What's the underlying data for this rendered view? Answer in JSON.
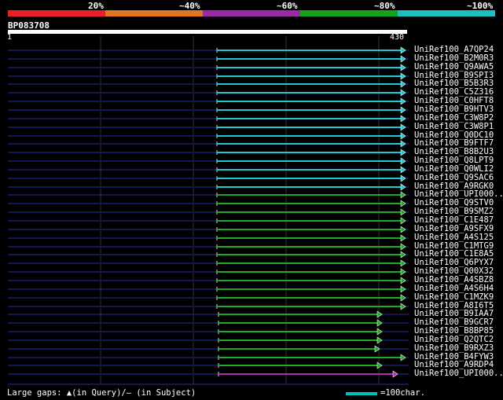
{
  "query": {
    "name": "BP083708",
    "start": "1",
    "end": "430"
  },
  "legend": {
    "labels": [
      "20%",
      "~40%",
      "~60%",
      "~80%",
      "~100%"
    ],
    "colors": [
      "#e8202a",
      "#e07820",
      "#9a2aa8",
      "#17a317",
      "#1fbfbf"
    ]
  },
  "footer": {
    "gaps_text": "Large gaps: ▲(in Query)/– (in Subject)",
    "scale_text": "=100char."
  },
  "hits": [
    {
      "label": "UniRef100_A7QP24",
      "color": "cyan",
      "kind": "long"
    },
    {
      "label": "UniRef100_B2M0R3",
      "color": "cyan",
      "kind": "long"
    },
    {
      "label": "UniRef100_Q9AWA5",
      "color": "cyan",
      "kind": "long"
    },
    {
      "label": "UniRef100_B9SPI3",
      "color": "cyan",
      "kind": "long"
    },
    {
      "label": "UniRef100_B5B3R3",
      "color": "cyan",
      "kind": "long"
    },
    {
      "label": "UniRef100_C5Z316",
      "color": "cyan",
      "kind": "long"
    },
    {
      "label": "UniRef100_C0HFT8",
      "color": "cyan",
      "kind": "long"
    },
    {
      "label": "UniRef100_B9HTV3",
      "color": "cyan",
      "kind": "long"
    },
    {
      "label": "UniRef100_C3W8P2",
      "color": "cyan",
      "kind": "long"
    },
    {
      "label": "UniRef100_C3W8P1",
      "color": "cyan",
      "kind": "long"
    },
    {
      "label": "UniRef100_Q0DC10",
      "color": "cyan",
      "kind": "long"
    },
    {
      "label": "UniRef100_B9FTF7",
      "color": "cyan",
      "kind": "long"
    },
    {
      "label": "UniRef100_B8B2U3",
      "color": "cyan",
      "kind": "long"
    },
    {
      "label": "UniRef100_Q8LPT9",
      "color": "cyan",
      "kind": "long"
    },
    {
      "label": "UniRef100_Q0WLI2",
      "color": "cyan",
      "kind": "long"
    },
    {
      "label": "UniRef100_Q9SAC6",
      "color": "cyan",
      "kind": "long"
    },
    {
      "label": "UniRef100_A9RGK0",
      "color": "cyan",
      "kind": "long"
    },
    {
      "label": "UniRef100_UPI000..",
      "color": "green",
      "kind": "long"
    },
    {
      "label": "UniRef100_Q9STV0",
      "color": "green",
      "kind": "long"
    },
    {
      "label": "UniRef100_B9SMZ2",
      "color": "green",
      "kind": "long"
    },
    {
      "label": "UniRef100_C1E487",
      "color": "green",
      "kind": "long"
    },
    {
      "label": "UniRef100_A9SFX9",
      "color": "green",
      "kind": "long"
    },
    {
      "label": "UniRef100_A4S125",
      "color": "green",
      "kind": "long"
    },
    {
      "label": "UniRef100_C1MTG9",
      "color": "green",
      "kind": "long"
    },
    {
      "label": "UniRef100_C1E8A5",
      "color": "green",
      "kind": "long"
    },
    {
      "label": "UniRef100_Q6PYX7",
      "color": "green",
      "kind": "long"
    },
    {
      "label": "UniRef100_Q00X32",
      "color": "green",
      "kind": "long"
    },
    {
      "label": "UniRef100_A4SBZ8",
      "color": "green",
      "kind": "long"
    },
    {
      "label": "UniRef100_A4S6H4",
      "color": "green",
      "kind": "long"
    },
    {
      "label": "UniRef100_C1MZK9",
      "color": "green",
      "kind": "long"
    },
    {
      "label": "UniRef100_A8I6T5",
      "color": "green",
      "kind": "long"
    },
    {
      "label": "UniRef100_B9IAA7",
      "color": "green",
      "kind": "short"
    },
    {
      "label": "UniRef100_B9GCR7",
      "color": "green",
      "kind": "short"
    },
    {
      "label": "UniRef100_B8BP85",
      "color": "green",
      "kind": "short"
    },
    {
      "label": "UniRef100_Q2QTC2",
      "color": "green",
      "kind": "short"
    },
    {
      "label": "UniRef100_B9RXZ3",
      "color": "green",
      "kind": "shorter"
    },
    {
      "label": "UniRef100_B4FYW3",
      "color": "green",
      "kind": "long2"
    },
    {
      "label": "UniRef100_A9RDP4",
      "color": "green",
      "kind": "short"
    },
    {
      "label": "UniRef100_UPI000..",
      "color": "purple",
      "kind": "purple"
    }
  ]
}
